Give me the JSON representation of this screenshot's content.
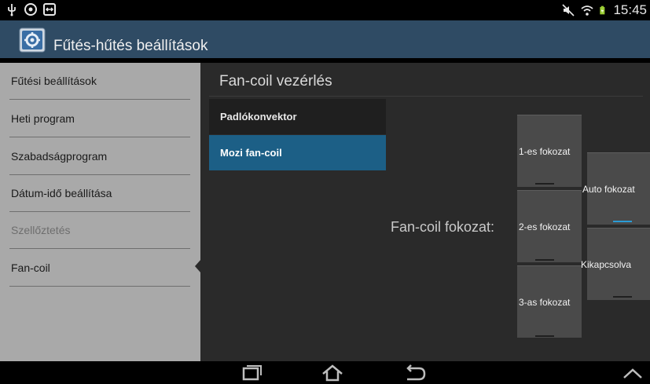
{
  "statusbar": {
    "time": "15:45",
    "left_icons": [
      "usb-icon",
      "eye-icon",
      "remote-icon"
    ],
    "right_icons": [
      "mute-icon",
      "wifi-icon",
      "battery-icon"
    ]
  },
  "actionbar": {
    "title": "Fűtés-hűtés beállítások",
    "icon": "settings-app-icon"
  },
  "sidebar": {
    "items": [
      {
        "label": "Fűtési beállítások",
        "enabled": true
      },
      {
        "label": "Heti program",
        "enabled": true
      },
      {
        "label": "Szabadságprogram",
        "enabled": true
      },
      {
        "label": "Dátum-idő beállítása",
        "enabled": true
      },
      {
        "label": "Szellőztetés",
        "enabled": false
      },
      {
        "label": "Fan-coil",
        "enabled": true,
        "selected": true
      }
    ]
  },
  "main": {
    "title": "Fan-coil vezérlés",
    "devices": [
      {
        "label": "Padlókonvektor",
        "selected": false
      },
      {
        "label": "Mozi fan-coil",
        "selected": true
      }
    ],
    "level_label": "Fan-coil fokozat:",
    "levels": [
      {
        "label": "1-es fokozat",
        "active": false
      },
      {
        "label": "2-es fokozat",
        "active": false
      },
      {
        "label": "3-as fokozat",
        "active": false
      },
      {
        "label": "Auto fokozat",
        "active": true
      },
      {
        "label": "Kikapcsolva",
        "active": false
      }
    ]
  },
  "navbar": {
    "icons": [
      "recent-apps-icon",
      "home-icon",
      "back-icon",
      "chevron-up-icon"
    ]
  },
  "colors": {
    "actionbar": "#2f4b64",
    "selected_device": "#1c5f86",
    "active_indicator": "#2a9bd6"
  }
}
